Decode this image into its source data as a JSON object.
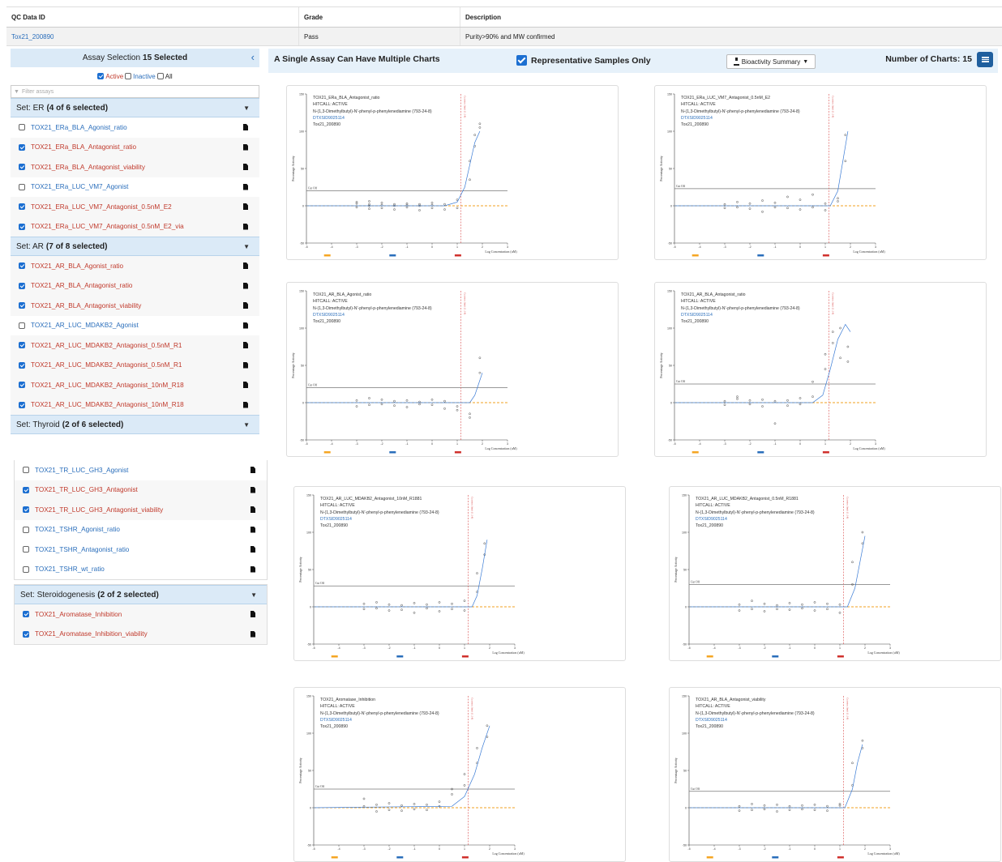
{
  "qc": {
    "headers": [
      "QC Data ID",
      "Grade",
      "Description"
    ],
    "row": {
      "id": "Tox21_200890",
      "grade": "Pass",
      "description": "Purity>90% and MW confirmed"
    }
  },
  "assay_panel": {
    "title": "Assay Selection",
    "selected": "15 Selected",
    "filters": {
      "active": "Active",
      "inactive": "Inactive",
      "all": "All"
    },
    "filter_placeholder": "Filter assays",
    "sets": [
      {
        "label": "Set: ER",
        "count": "(4 of 6 selected)",
        "items": [
          {
            "name": "TOX21_ERa_BLA_Agonist_ratio",
            "checked": false
          },
          {
            "name": "TOX21_ERa_BLA_Antagonist_ratio",
            "checked": true
          },
          {
            "name": "TOX21_ERa_BLA_Antagonist_viability",
            "checked": true
          },
          {
            "name": "TOX21_ERa_LUC_VM7_Agonist",
            "checked": false
          },
          {
            "name": "TOX21_ERa_LUC_VM7_Antagonist_0.5nM_E2",
            "checked": true
          },
          {
            "name": "TOX21_ERa_LUC_VM7_Antagonist_0.5nM_E2_via",
            "checked": true
          }
        ]
      },
      {
        "label": "Set: AR",
        "count": "(7 of 8 selected)",
        "items": [
          {
            "name": "TOX21_AR_BLA_Agonist_ratio",
            "checked": true
          },
          {
            "name": "TOX21_AR_BLA_Antagonist_ratio",
            "checked": true
          },
          {
            "name": "TOX21_AR_BLA_Antagonist_viability",
            "checked": true
          },
          {
            "name": "TOX21_AR_LUC_MDAKB2_Agonist",
            "checked": false
          },
          {
            "name": "TOX21_AR_LUC_MDAKB2_Antagonist_0.5nM_R1",
            "checked": true
          },
          {
            "name": "TOX21_AR_LUC_MDAKB2_Antagonist_0.5nM_R1",
            "checked": true
          },
          {
            "name": "TOX21_AR_LUC_MDAKB2_Antagonist_10nM_R18",
            "checked": true
          },
          {
            "name": "TOX21_AR_LUC_MDAKB2_Antagonist_10nM_R18",
            "checked": true
          }
        ]
      },
      {
        "label": "Set: Thyroid",
        "count": "(2 of 6 selected)",
        "items": [
          {
            "name": "TOX21_TR_LUC_GH3_Agonist",
            "checked": false
          },
          {
            "name": "TOX21_TR_LUC_GH3_Antagonist",
            "checked": true
          },
          {
            "name": "TOX21_TR_LUC_GH3_Antagonist_viability",
            "checked": true
          },
          {
            "name": "TOX21_TSHR_Agonist_ratio",
            "checked": false
          },
          {
            "name": "TOX21_TSHR_Antagonist_ratio",
            "checked": false
          },
          {
            "name": "TOX21_TSHR_wt_ratio",
            "checked": false
          }
        ]
      },
      {
        "label": "Set: Steroidogenesis",
        "count": "(2 of 2 selected)",
        "items": [
          {
            "name": "TOX21_Aromatase_Inhibition",
            "checked": true
          },
          {
            "name": "TOX21_Aromatase_Inhibition_viability",
            "checked": true
          }
        ]
      }
    ]
  },
  "topbar": {
    "title": "A Single Assay Can Have Multiple Charts",
    "representative": "Representative Samples Only",
    "bioactivity": "Bioactivity Summary",
    "num_charts": "Number of Charts: 15"
  },
  "chart_common": {
    "hitcall": "HITCALL: ACTIVE",
    "chemical": "N-(1,3-Dimethylbutyl)-N'-phenyl-p-phenylenediamine (793-24-8)",
    "dtxsid": "DTXSID9025114",
    "sample": "Tox21_200890",
    "ylabel": "Percentage Activity",
    "xlabel": "Log Concentration (uM)",
    "cutoff_label": "Cut Off",
    "cytotox_label": "Cytotox limit (1.14)",
    "x_ticks": [
      "-5",
      "-4",
      "-3",
      "-2",
      "-1",
      "0",
      "1",
      "2",
      "3"
    ],
    "y_ticks": [
      "150",
      "100",
      "50",
      "0",
      "-50"
    ],
    "colors": {
      "curve": "#3a7bd5",
      "cutoff": "#777777",
      "baseline": "#f0a020",
      "cytotox": "#d94c4c",
      "ac50": "#4a7fd0",
      "band_low": "#f5a623",
      "band_mid": "#2a6ebb",
      "band_high": "#d0312d"
    }
  },
  "chart_data": [
    {
      "type": "scatter",
      "title": "TOX21_ERa_BLA_Antagonist_ratio",
      "cutoff": 20,
      "ac50_label": "AC50 (1.54)",
      "x": [
        -3,
        -3,
        -3,
        -2.5,
        -2.5,
        -2.5,
        -2.5,
        -2,
        -2,
        -2,
        -1.5,
        -1.5,
        -1.5,
        -1,
        -1,
        -1,
        -0.5,
        -0.5,
        -0.5,
        0,
        0,
        0,
        0.5,
        0.5,
        1,
        1,
        1.5,
        1.5,
        1.7,
        1.7,
        1.9,
        1.9
      ],
      "y": [
        3,
        -2,
        5,
        6,
        -4,
        2,
        0,
        4,
        -3,
        1,
        2,
        -5,
        0,
        3,
        -2,
        1,
        -6,
        2,
        0,
        4,
        -3,
        1,
        -5,
        2,
        8,
        -3,
        35,
        60,
        80,
        95,
        105,
        110
      ],
      "curve": [
        [
          -5,
          0
        ],
        [
          0.5,
          0
        ],
        [
          1.0,
          5
        ],
        [
          1.3,
          25
        ],
        [
          1.5,
          55
        ],
        [
          1.7,
          85
        ],
        [
          1.9,
          100
        ]
      ]
    },
    {
      "type": "scatter",
      "title": "TOX21_ERa_LUC_VM7_Antagonist_0.5nM_E2",
      "cutoff": 23,
      "ac50_label": "AC50 (1.68)",
      "x": [
        -3,
        -3,
        -2.5,
        -2.5,
        -2,
        -2,
        -1.5,
        -1.5,
        -1,
        -1,
        -0.5,
        -0.5,
        0,
        0,
        0.5,
        0.5,
        1,
        1,
        1.5,
        1.5,
        1.8,
        1.8
      ],
      "y": [
        2,
        -3,
        5,
        -2,
        3,
        -4,
        7,
        -8,
        4,
        -2,
        12,
        -3,
        8,
        -5,
        15,
        -2,
        3,
        -6,
        6,
        10,
        60,
        95
      ],
      "curve": [
        [
          -5,
          0
        ],
        [
          1.2,
          0
        ],
        [
          1.5,
          20
        ],
        [
          1.7,
          60
        ],
        [
          1.9,
          100
        ]
      ]
    },
    {
      "type": "scatter",
      "title": "TOX21_AR_BLA_Agonist_ratio",
      "cutoff": 20,
      "ac50_label": "AC50 (1.84)",
      "x": [
        -3,
        -3,
        -2.5,
        -2.5,
        -2,
        -2,
        -1.5,
        -1.5,
        -1,
        -1,
        -0.5,
        -0.5,
        0,
        0,
        0.5,
        0.5,
        1,
        1,
        1.5,
        1.5,
        1.9,
        1.9
      ],
      "y": [
        3,
        -5,
        6,
        -3,
        4,
        -2,
        2,
        -4,
        3,
        -6,
        1,
        -2,
        4,
        -3,
        2,
        -8,
        -5,
        -10,
        -15,
        -20,
        40,
        60
      ],
      "curve": [
        [
          -5,
          0
        ],
        [
          1.5,
          0
        ],
        [
          1.7,
          10
        ],
        [
          1.9,
          30
        ],
        [
          2.0,
          40
        ]
      ]
    },
    {
      "type": "scatter",
      "title": "TOX21_AR_BLA_Antagonist_ratio",
      "cutoff": 25,
      "ac50_label": "AC50 (1.30)",
      "x": [
        -3,
        -3,
        -2.5,
        -2.5,
        -2,
        -2,
        -1.5,
        -1.5,
        -1,
        -1,
        -0.5,
        -0.5,
        0,
        0,
        0.5,
        0.5,
        1,
        1,
        1.3,
        1.3,
        1.6,
        1.6,
        1.9,
        1.9
      ],
      "y": [
        2,
        -3,
        5,
        8,
        3,
        -2,
        4,
        -5,
        2,
        -28,
        3,
        -4,
        6,
        -2,
        28,
        8,
        65,
        45,
        80,
        95,
        60,
        100,
        75,
        55
      ],
      "curve": [
        [
          -5,
          0
        ],
        [
          0.5,
          0
        ],
        [
          0.9,
          10
        ],
        [
          1.2,
          45
        ],
        [
          1.5,
          85
        ],
        [
          1.8,
          105
        ],
        [
          2.0,
          95
        ]
      ]
    },
    {
      "type": "scatter",
      "title": "TOX21_AR_LUC_MDAKB2_Antagonist_10nM_R1881",
      "cutoff": 28,
      "ac50_label": "AC50 (1.73)",
      "x": [
        -3,
        -3,
        -2.5,
        -2.5,
        -2,
        -2,
        -1.5,
        -1.5,
        -1,
        -1,
        -0.5,
        -0.5,
        0,
        0,
        0.5,
        0.5,
        1,
        1,
        1.5,
        1.5,
        1.8,
        1.8
      ],
      "y": [
        4,
        -3,
        6,
        -2,
        3,
        -5,
        2,
        -4,
        5,
        -8,
        3,
        -2,
        6,
        -6,
        4,
        -3,
        8,
        -5,
        20,
        45,
        70,
        85
      ],
      "curve": [
        [
          -5,
          0
        ],
        [
          1.3,
          0
        ],
        [
          1.5,
          15
        ],
        [
          1.7,
          50
        ],
        [
          1.9,
          90
        ]
      ]
    },
    {
      "type": "scatter",
      "title": "TOX21_AR_LUC_MDAKB2_Antagonist_0.5nM_R1881",
      "cutoff": 30,
      "ac50_label": "AC50 (1.88)",
      "x": [
        -3,
        -3,
        -2.5,
        -2.5,
        -2,
        -2,
        -1.5,
        -1.5,
        -1,
        -1,
        -0.5,
        -0.5,
        0,
        0,
        0.5,
        0.5,
        1,
        1,
        1.5,
        1.5,
        1.9,
        1.9
      ],
      "y": [
        3,
        -5,
        8,
        -3,
        4,
        -6,
        2,
        -3,
        5,
        -4,
        3,
        -2,
        6,
        -5,
        4,
        -3,
        3,
        -8,
        30,
        60,
        85,
        100
      ],
      "curve": [
        [
          -5,
          0
        ],
        [
          1.3,
          0
        ],
        [
          1.6,
          25
        ],
        [
          1.8,
          60
        ],
        [
          2.0,
          95
        ]
      ]
    },
    {
      "type": "scatter",
      "title": "TOX21_Aromatase_Inhibition",
      "cutoff": 25,
      "ac50_label": "AC50 (1.73)",
      "x": [
        -3,
        -3,
        -2.5,
        -2.5,
        -2,
        -2,
        -1.5,
        -1.5,
        -1,
        -1,
        -0.5,
        -0.5,
        0,
        0,
        0.5,
        0.5,
        1,
        1,
        1.5,
        1.5,
        1.9,
        1.9
      ],
      "y": [
        12,
        2,
        4,
        -5,
        6,
        -3,
        3,
        -4,
        5,
        -2,
        4,
        -3,
        8,
        2,
        18,
        25,
        30,
        45,
        60,
        80,
        95,
        110
      ],
      "curve": [
        [
          -5,
          0
        ],
        [
          0.5,
          2
        ],
        [
          1.0,
          15
        ],
        [
          1.4,
          45
        ],
        [
          1.7,
          80
        ],
        [
          2.0,
          110
        ]
      ]
    },
    {
      "type": "scatter",
      "title": "TOX21_AR_BLA_Antagonist_viability",
      "cutoff": 22,
      "ac50_label": "AC50 (1.65)",
      "x": [
        -3,
        -3,
        -2.5,
        -2.5,
        -2,
        -2,
        -1.5,
        -1.5,
        -1,
        -1,
        -0.5,
        -0.5,
        0,
        0,
        0.5,
        0.5,
        1,
        1,
        1.5,
        1.5,
        1.9,
        1.9
      ],
      "y": [
        2,
        -4,
        5,
        -3,
        3,
        -2,
        4,
        -5,
        2,
        -3,
        3,
        -2,
        4,
        -3,
        2,
        -4,
        3,
        5,
        30,
        60,
        80,
        90
      ],
      "curve": [
        [
          -5,
          0
        ],
        [
          1.2,
          0
        ],
        [
          1.5,
          25
        ],
        [
          1.7,
          60
        ],
        [
          1.9,
          85
        ]
      ]
    }
  ]
}
